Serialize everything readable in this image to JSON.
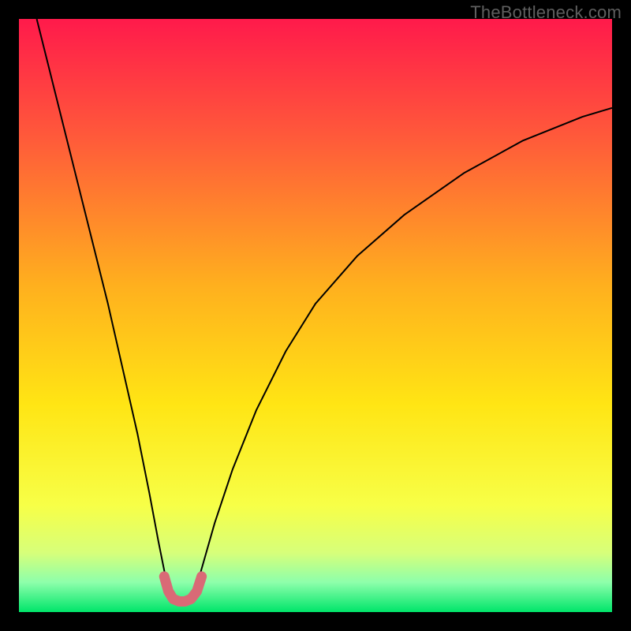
{
  "watermark": "TheBottleneck.com",
  "chart_data": {
    "type": "line",
    "title": "",
    "xlabel": "",
    "ylabel": "",
    "xlim": [
      0,
      100
    ],
    "ylim": [
      0,
      100
    ],
    "background_gradient": {
      "stops": [
        {
          "offset": 0.0,
          "color": "#ff1a4b"
        },
        {
          "offset": 0.2,
          "color": "#ff5a3a"
        },
        {
          "offset": 0.45,
          "color": "#ffb01e"
        },
        {
          "offset": 0.65,
          "color": "#ffe514"
        },
        {
          "offset": 0.82,
          "color": "#f7ff47"
        },
        {
          "offset": 0.9,
          "color": "#d7ff7a"
        },
        {
          "offset": 0.95,
          "color": "#8dffab"
        },
        {
          "offset": 1.0,
          "color": "#00e56a"
        }
      ]
    },
    "series": [
      {
        "name": "left-branch",
        "stroke": "#000000",
        "stroke_width": 2,
        "x": [
          3.0,
          5.0,
          7.5,
          10.0,
          12.5,
          15.0,
          17.5,
          20.0,
          22.0,
          23.5,
          24.5,
          25.0
        ],
        "y": [
          100.0,
          92.0,
          82.0,
          72.0,
          62.0,
          52.0,
          41.0,
          30.0,
          20.0,
          12.0,
          7.0,
          4.5
        ]
      },
      {
        "name": "right-branch",
        "stroke": "#000000",
        "stroke_width": 2,
        "x": [
          30.0,
          31.0,
          33.0,
          36.0,
          40.0,
          45.0,
          50.0,
          57.0,
          65.0,
          75.0,
          85.0,
          95.0,
          100.0
        ],
        "y": [
          4.5,
          8.0,
          15.0,
          24.0,
          34.0,
          44.0,
          52.0,
          60.0,
          67.0,
          74.0,
          79.5,
          83.5,
          85.0
        ]
      },
      {
        "name": "valley-highlight",
        "stroke": "#d96a76",
        "stroke_width": 13,
        "linecap": "round",
        "x": [
          24.5,
          25.2,
          26.0,
          27.0,
          28.0,
          29.0,
          30.0,
          30.8
        ],
        "y": [
          6.0,
          3.5,
          2.2,
          1.8,
          1.8,
          2.2,
          3.5,
          6.0
        ]
      }
    ]
  }
}
